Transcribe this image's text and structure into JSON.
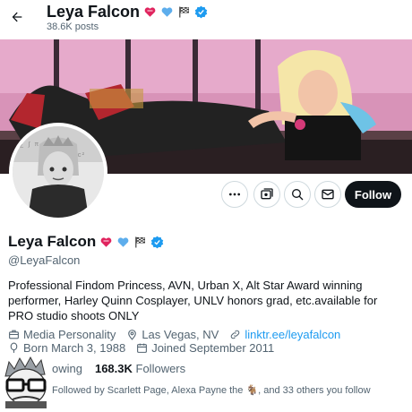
{
  "header": {
    "name": "Leya Falcon",
    "posts_count": "38.6K posts",
    "name_emojis": [
      "heart-with-ribbon",
      "blue-heart",
      "checkered-flag"
    ]
  },
  "actions": {
    "follow_label": "Follow"
  },
  "profile": {
    "name": "Leya Falcon",
    "handle": "@LeyaFalcon",
    "bio": "Professional Findom Princess, AVN, Urban X, Alt Star Award winning performer, Harley Quinn Cosplayer, UNLV honors grad, etc.available for PRO studio shoots ONLY",
    "category": "Media Personality",
    "location": "Las Vegas, NV",
    "website": "linktr.ee/leyafalcon",
    "birthday": "Born March 3, 1988",
    "joined": "Joined September 2011"
  },
  "stats": {
    "following_partial": "owing",
    "followers_count": "168.3K",
    "followers_label": "Followers"
  },
  "followed_by": "Followed by Scarlett Page, Alexa Payne the 🐐, and 33 others you follow",
  "colors": {
    "accent": "#1d9bf0",
    "follow_bg": "#0f1419",
    "secondary_text": "#536471"
  }
}
